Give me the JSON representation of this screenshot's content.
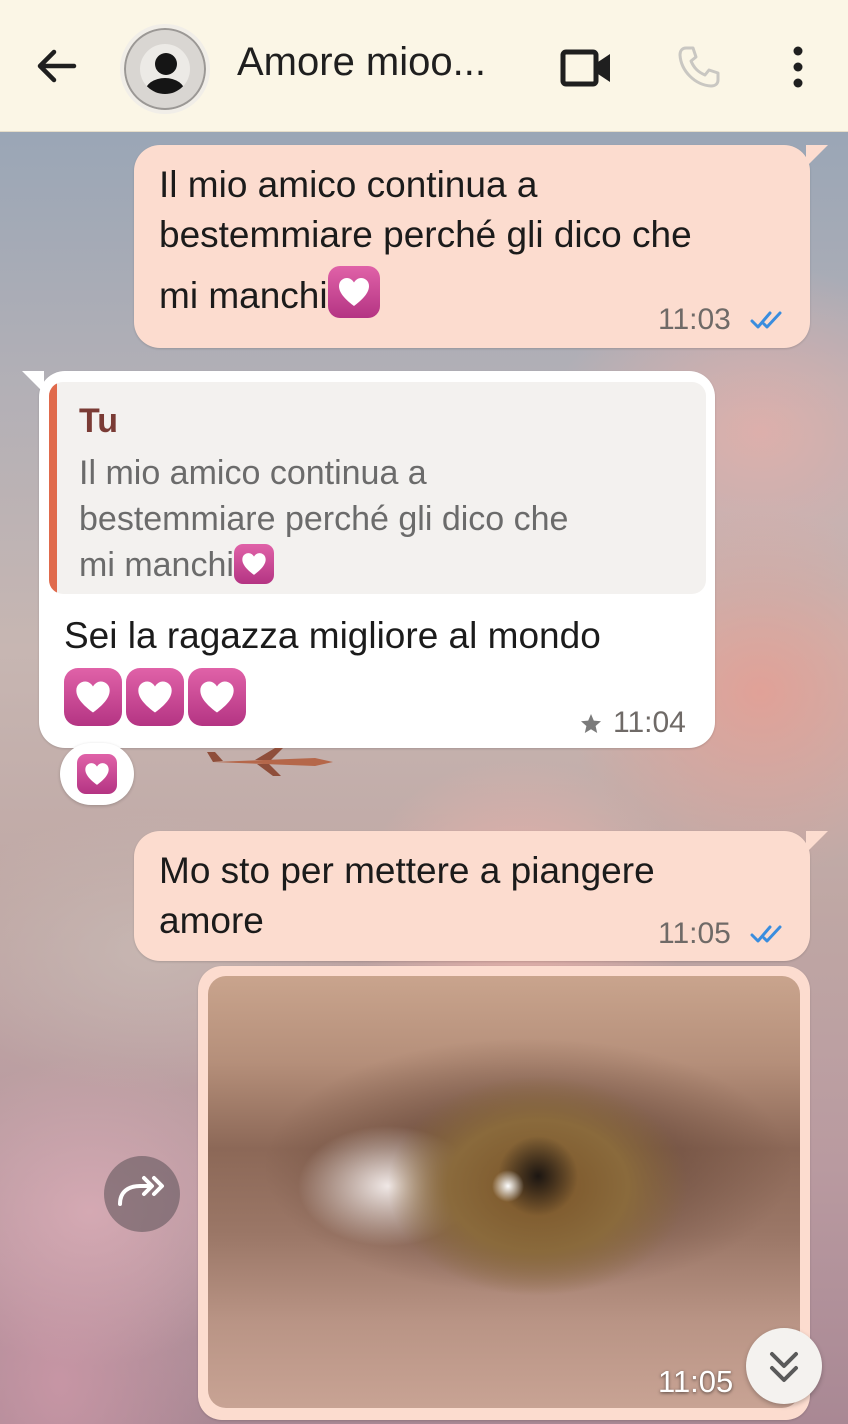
{
  "header": {
    "contact_name": "Amore mioo...",
    "icons": {
      "back": "arrow-left-icon",
      "video": "video-camera-icon",
      "call": "phone-icon",
      "menu": "more-vertical-icon"
    }
  },
  "messages": [
    {
      "direction": "outgoing",
      "lines": [
        "Il mio amico continua a",
        "bestemmiare perché gli dico che",
        "mi manchi"
      ],
      "emoji": "heart",
      "time": "11:03",
      "status": "read"
    },
    {
      "direction": "incoming",
      "quote": {
        "author": "Tu",
        "lines": [
          "Il mio amico continua a",
          "bestemmiare perché gli dico che",
          "mi manchi"
        ]
      },
      "text": "Sei la ragazza migliore al mondo",
      "emoji_count": 3,
      "time": "11:04",
      "starred": true,
      "reaction": "heart"
    },
    {
      "direction": "outgoing",
      "lines": [
        "Mo sto per mettere a piangere",
        "amore"
      ],
      "time": "11:05",
      "status": "read"
    },
    {
      "direction": "outgoing",
      "type": "image",
      "time": "11:05"
    }
  ],
  "colors": {
    "header_bg": "#fbf6e6",
    "outgoing_bubble": "#fcdccf",
    "incoming_bubble": "#ffffff",
    "read_ticks": "#3a8dde",
    "quote_bar": "#e06a4c",
    "quote_author": "#7a3b35"
  }
}
